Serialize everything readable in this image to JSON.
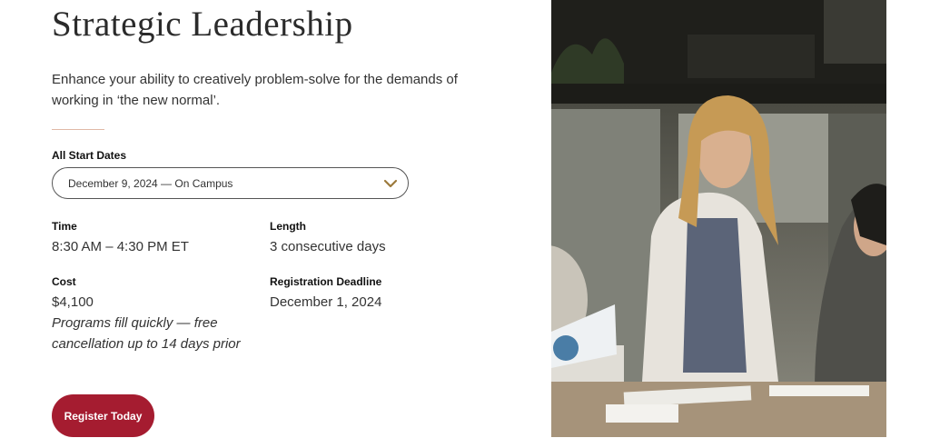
{
  "course": {
    "title": "Strategic Leadership",
    "description": "Enhance your ability to creatively problem-solve for the demands of working in ‘the new normal’."
  },
  "start_dates": {
    "label": "All Start Dates",
    "selected": "December 9, 2024 — On Campus",
    "icon": "chevron-down-icon",
    "accent_color": "#9c7a3c"
  },
  "details": {
    "time_label": "Time",
    "time_value": "8:30 AM – 4:30 PM ET",
    "length_label": "Length",
    "length_value": "3 consecutive days",
    "cost_label": "Cost",
    "cost_value": "$4,100",
    "cost_note": "Programs fill quickly — free cancellation up to 14 days prior",
    "deadline_label": "Registration Deadline",
    "deadline_value": "December 1, 2024"
  },
  "cta": {
    "label": "Register Today",
    "color": "#a51c30"
  }
}
